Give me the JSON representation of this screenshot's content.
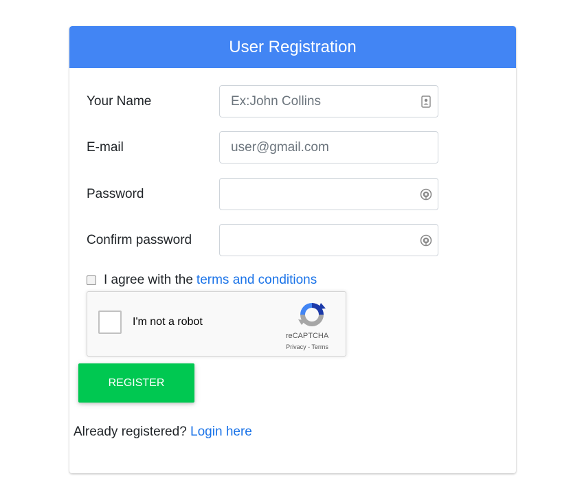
{
  "header": {
    "title": "User Registration"
  },
  "form": {
    "name": {
      "label": "Your Name",
      "placeholder": "Ex:John Collins",
      "value": "",
      "icon": "contact-card-icon"
    },
    "email": {
      "label": "E-mail",
      "placeholder": "user@gmail.com",
      "value": ""
    },
    "password": {
      "label": "Password",
      "placeholder": "",
      "value": "",
      "icon": "password-key-icon"
    },
    "confirm_password": {
      "label": "Confirm password",
      "placeholder": "",
      "value": "",
      "icon": "password-key-icon"
    },
    "agree": {
      "text": "I agree with the",
      "link": "terms and conditions",
      "checked": false
    },
    "recaptcha": {
      "label": "I'm not a robot",
      "brand": "reCAPTCHA",
      "links": "Privacy - Terms"
    },
    "register_label": "REGISTER",
    "already": {
      "text": "Already registered?",
      "link": "Login here"
    }
  },
  "colors": {
    "header": "#4285f4",
    "register": "#00c851",
    "link": "#1a73e8"
  }
}
